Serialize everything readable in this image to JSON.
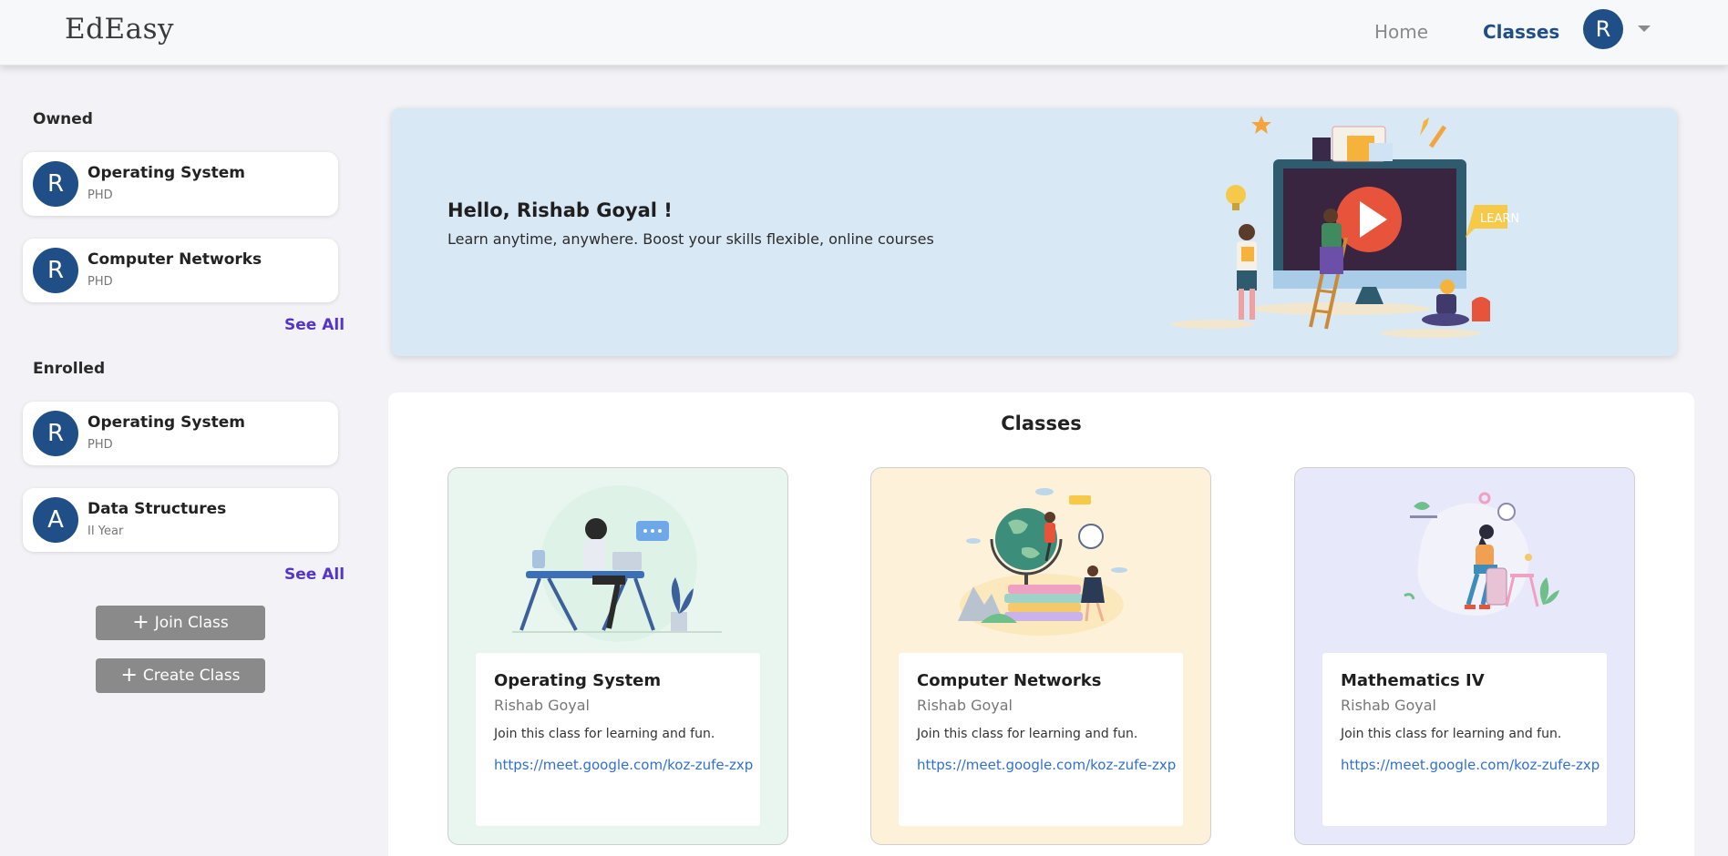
{
  "header": {
    "brand": "EdEasy",
    "nav_home": "Home",
    "nav_classes": "Classes",
    "avatar_letter": "R"
  },
  "sidebar": {
    "owned_heading": "Owned",
    "owned": [
      {
        "avatar": "R",
        "name": "Operating System",
        "sub": "PHD"
      },
      {
        "avatar": "R",
        "name": "Computer Networks",
        "sub": "PHD"
      }
    ],
    "enrolled_heading": "Enrolled",
    "enrolled": [
      {
        "avatar": "R",
        "name": "Operating System",
        "sub": "PHD"
      },
      {
        "avatar": "A",
        "name": "Data Structures",
        "sub": "II Year"
      }
    ],
    "see_all": "See All",
    "join_label": "Join Class",
    "create_label": "Create Class",
    "plus_icon": "+"
  },
  "banner": {
    "greeting": "Hello, Rishab Goyal !",
    "tagline": "Learn anytime, anywhere. Boost your skills flexible, online courses",
    "illustration_text": "LEARN"
  },
  "classes": {
    "title": "Classes",
    "cards": [
      {
        "name": "Operating System",
        "teacher": "Rishab Goyal",
        "description": "Join this class for learning and fun.",
        "link": "https://meet.google.com/koz-zufe-zxp",
        "bg": "#e9f6ef"
      },
      {
        "name": "Computer Networks",
        "teacher": "Rishab Goyal",
        "description": "Join this class for learning and fun.",
        "link": "https://meet.google.com/koz-zufe-zxp",
        "bg": "#fdf2d9"
      },
      {
        "name": "Mathematics IV",
        "teacher": "Rishab Goyal",
        "description": "Join this class for learning and fun.",
        "link": "https://meet.google.com/koz-zufe-zxp",
        "bg": "#e8e8fb"
      }
    ]
  },
  "colors": {
    "primary": "#1f4f86",
    "see_all": "#5434c9",
    "link": "#2f6fd6",
    "banner_bg": "#d8e8f5",
    "button_gray": "#8a8a8a"
  }
}
